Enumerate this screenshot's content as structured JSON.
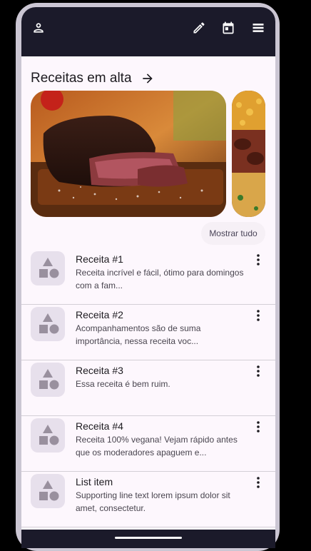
{
  "appbar": {
    "icons": [
      "person-icon",
      "edit-icon",
      "calendar-icon",
      "menu-icon"
    ]
  },
  "trending": {
    "title": "Receitas em alta",
    "show_all": "Mostrar tudo"
  },
  "recipes": [
    {
      "title": "Receita #1",
      "subtitle": "Receita incrível e fácil, ótimo para domingos com a fam..."
    },
    {
      "title": "Receita #2",
      "subtitle": "Acompanhamentos são de suma importância, nessa receita voc..."
    },
    {
      "title": "Receita #3",
      "subtitle": "Essa receita é bem ruim."
    },
    {
      "title": "Receita #4",
      "subtitle": "Receita 100% vegana! Vejam rápido antes que os moderadores apaguem e..."
    },
    {
      "title": "List item",
      "subtitle": "Supporting line text lorem ipsum dolor sit amet, consectetur."
    }
  ],
  "colors": {
    "appbar": "#1b1a2a",
    "surface": "#fdf7fd",
    "placeholder": "#e7e0ec"
  }
}
